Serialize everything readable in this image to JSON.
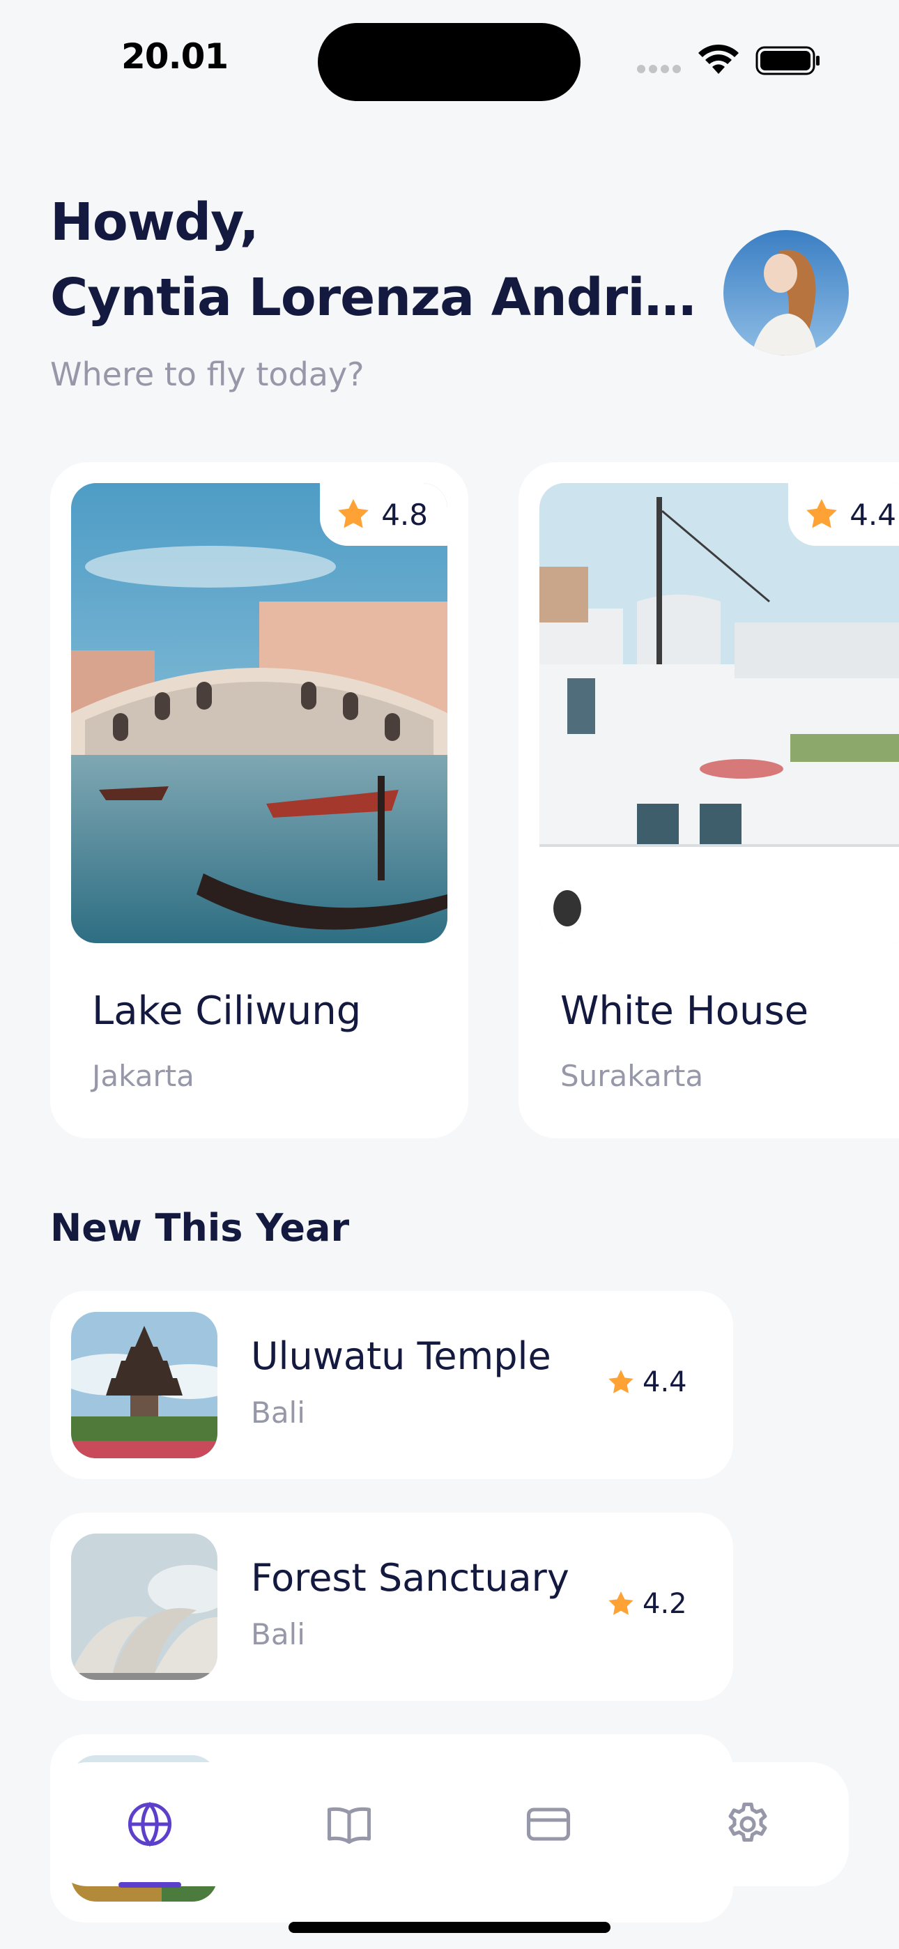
{
  "status_bar": {
    "time": "20.01"
  },
  "header": {
    "greeting": "Howdy,",
    "username": "Cyntia Lorenza Andriaharjo",
    "subtitle": "Where to fly today?"
  },
  "destinations": [
    {
      "name": "Lake Ciliwung",
      "city": "Jakarta",
      "rating": "4.8"
    },
    {
      "name": "White House",
      "city": "Surakarta",
      "rating": "4.4"
    }
  ],
  "section": {
    "title": "New This Year"
  },
  "new_this_year": [
    {
      "name": "Uluwatu Temple",
      "city": "Bali",
      "rating": "4.4"
    },
    {
      "name": "Forest Sanctuary",
      "city": "Bali",
      "rating": "4.2"
    }
  ],
  "nav": {
    "items": [
      {
        "icon": "globe-icon",
        "active": true
      },
      {
        "icon": "book-icon",
        "active": false
      },
      {
        "icon": "card-icon",
        "active": false
      },
      {
        "icon": "settings-icon",
        "active": false
      }
    ],
    "active_color": "#5C40CC",
    "inactive_color": "#9698A9"
  },
  "colors": {
    "primary_text": "#14193F",
    "secondary_text": "#9698A9",
    "accent": "#5C40CC",
    "star": "#FFA235",
    "background": "#F6F7F8"
  }
}
